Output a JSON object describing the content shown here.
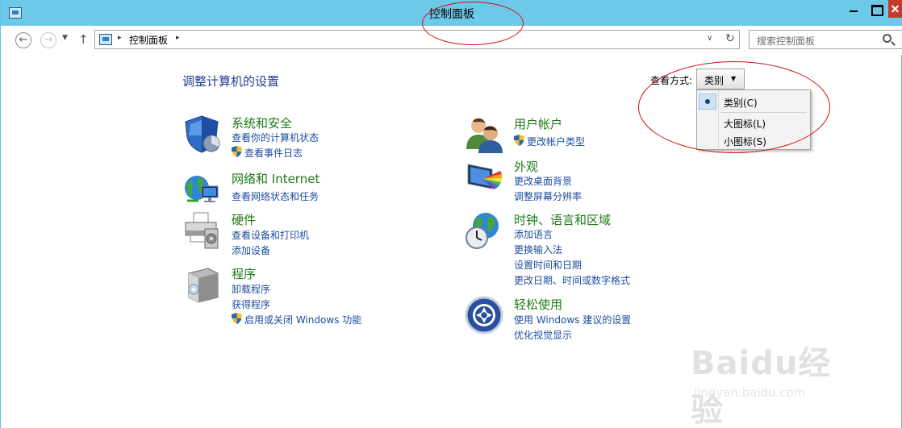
{
  "window": {
    "title": "控制面板"
  },
  "navbar": {
    "back_glyph": "←",
    "forward_glyph": "→",
    "dropdown_glyph": "▼",
    "up_glyph": "↑",
    "address_path": "控制面板",
    "address_sep": "▸",
    "address_dropdown_glyph": "∨",
    "refresh_glyph": "↻",
    "search_placeholder": "搜索控制面板"
  },
  "content": {
    "page_title": "调整计算机的设置",
    "view_by_label": "查看方式:",
    "view_by_value": "类别",
    "view_by_caret": "▼",
    "view_menu": [
      "类别(C)",
      "大图标(L)",
      "小图标(S)"
    ]
  },
  "categories": {
    "system": {
      "title": "系统和安全",
      "links": [
        "查看你的计算机状态",
        "查看事件日志"
      ]
    },
    "network": {
      "title": "网络和 Internet",
      "links": [
        "查看网络状态和任务"
      ]
    },
    "hardware": {
      "title": "硬件",
      "links": [
        "查看设备和打印机",
        "添加设备"
      ]
    },
    "programs": {
      "title": "程序",
      "links": [
        "卸载程序",
        "获得程序",
        "启用或关闭 Windows 功能"
      ]
    },
    "accounts": {
      "title": "用户帐户",
      "links": [
        "更改帐户类型"
      ]
    },
    "appearance": {
      "title": "外观",
      "links": [
        "更改桌面背景",
        "调整屏幕分辨率"
      ]
    },
    "clock": {
      "title": "时钟、语言和区域",
      "links": [
        "添加语言",
        "更换输入法",
        "设置时间和日期",
        "更改日期、时间或数字格式"
      ]
    },
    "ease": {
      "title": "轻松使用",
      "links": [
        "使用 Windows 建议的设置",
        "优化视觉显示"
      ]
    }
  },
  "watermark": {
    "brand": "Baidu经验",
    "url": "jingyan.baidu.com"
  },
  "colors": {
    "titlebar": "#6ccae8",
    "category_title": "#1e7a16",
    "link": "#1c4c9f",
    "annotation": "#d40e0e"
  }
}
